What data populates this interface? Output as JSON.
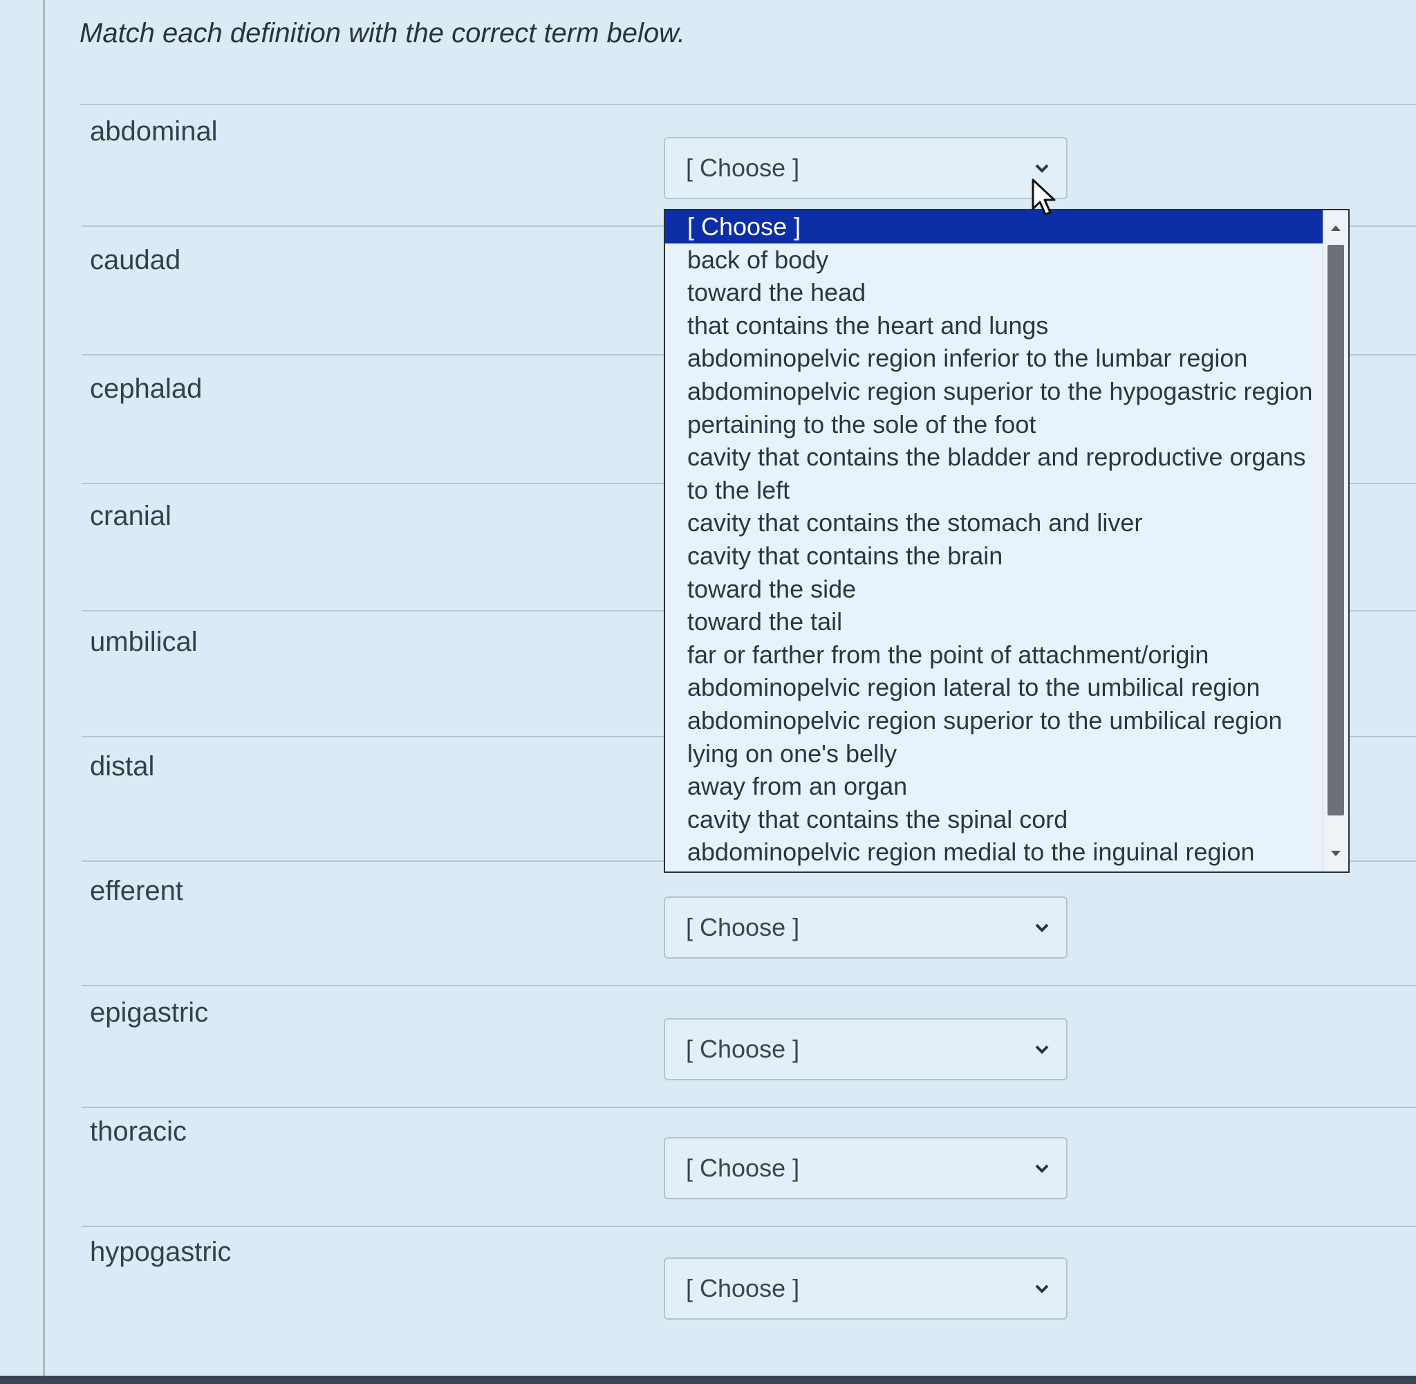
{
  "heading": "Match each definition with the correct term below.",
  "select_placeholder": "[ Choose ]",
  "terms": [
    "abdominal",
    "caudad",
    "cephalad",
    "cranial",
    "umbilical",
    "distal",
    "efferent",
    "epigastric",
    "thoracic",
    "hypogastric"
  ],
  "dropdown": {
    "selected_index": 0,
    "options": [
      "[ Choose ]",
      "back of body",
      "toward the head",
      "that contains the heart and lungs",
      "abdominopelvic region inferior to the lumbar region",
      "abdominopelvic region superior to the hypogastric region",
      "pertaining to the sole of the foot",
      "cavity that contains the bladder and reproductive organs",
      "to the left",
      "cavity that contains the stomach and liver",
      "cavity that contains the brain",
      "toward the side",
      "toward the tail",
      "far or farther from the point of attachment/origin",
      "abdominopelvic region lateral to the umbilical region",
      "abdominopelvic region superior to the umbilical region",
      "lying on one's belly",
      "away from an organ",
      "cavity that contains the spinal cord",
      "abdominopelvic region medial to the inguinal region"
    ]
  },
  "colors": {
    "selected_option": "#0c2fa8",
    "background": "#dbebf6"
  }
}
